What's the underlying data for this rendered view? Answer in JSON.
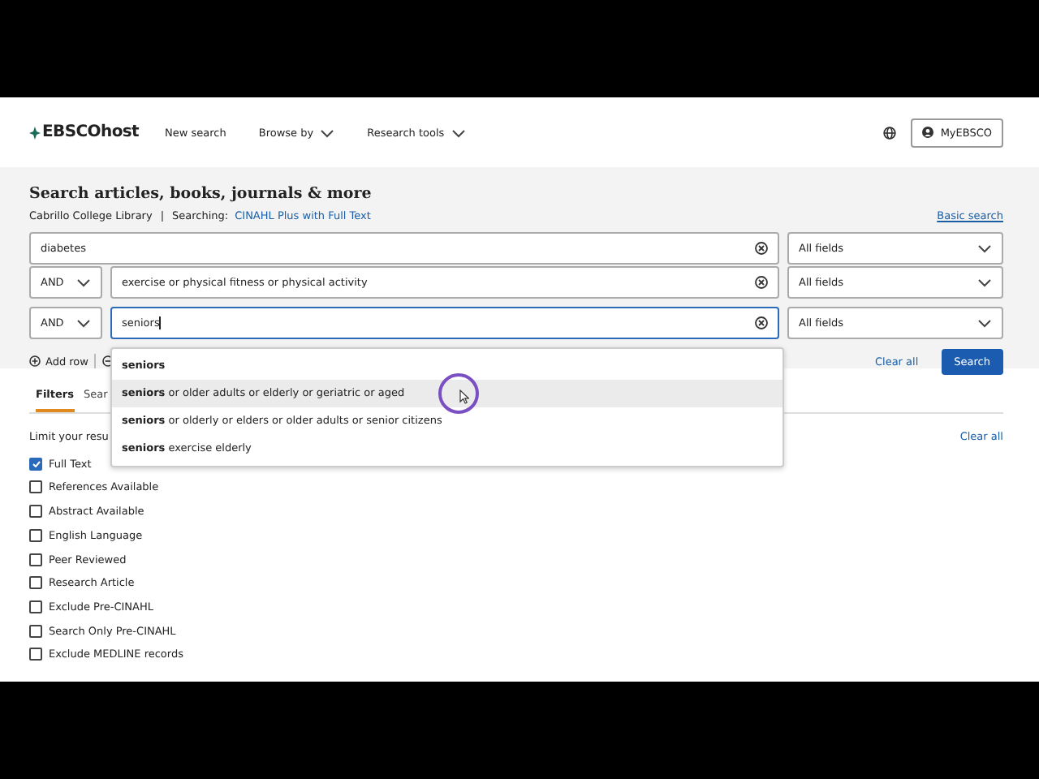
{
  "header": {
    "logo": "EBSCOhost",
    "nav": [
      {
        "label": "New search",
        "dropdown": false
      },
      {
        "label": "Browse by",
        "dropdown": true
      },
      {
        "label": "Research tools",
        "dropdown": true
      }
    ],
    "account_button": "MyEBSCO"
  },
  "search_panel": {
    "title": "Search articles, books, journals & more",
    "library": "Cabrillo College Library",
    "separator": "|",
    "searching_label": "Searching:",
    "database": "CINAHL Plus with Full Text",
    "basic_search_link": "Basic search",
    "rows": [
      {
        "value": "diabetes",
        "field": "All fields",
        "focused": false
      },
      {
        "operator": "AND",
        "value": "exercise or physical fitness or physical activity",
        "field": "All fields",
        "focused": false
      },
      {
        "operator": "AND",
        "value": "seniors",
        "field": "All fields",
        "focused": true
      }
    ],
    "suggestions": [
      {
        "text": "**seniors**",
        "selected": false
      },
      {
        "text": "**seniors** or older adults or elderly or geriatric or aged",
        "selected": true
      },
      {
        "text": "**seniors** or olderly or elders or older adults or senior citizens",
        "selected": false
      },
      {
        "text": "**seniors** exercise elderly",
        "selected": false
      }
    ],
    "add_row": "Add row",
    "clear_all": "Clear all",
    "search_button": "Search"
  },
  "tabs": [
    {
      "label": "Filters",
      "selected": true
    },
    {
      "label": "Sear",
      "selected": false
    }
  ],
  "filters": {
    "heading": "Limit your resu",
    "clear_all": "Clear all",
    "options": [
      {
        "label": "Full Text",
        "checked": true
      },
      {
        "label": "References Available",
        "checked": false
      },
      {
        "label": "Abstract Available",
        "checked": false
      },
      {
        "label": "English Language",
        "checked": false
      },
      {
        "label": "Peer Reviewed",
        "checked": false
      },
      {
        "label": "Research Article",
        "checked": false
      },
      {
        "label": "Exclude Pre-CINAHL",
        "checked": false
      },
      {
        "label": "Search Only Pre-CINAHL",
        "checked": false
      },
      {
        "label": "Exclude MEDLINE records",
        "checked": false
      }
    ]
  }
}
